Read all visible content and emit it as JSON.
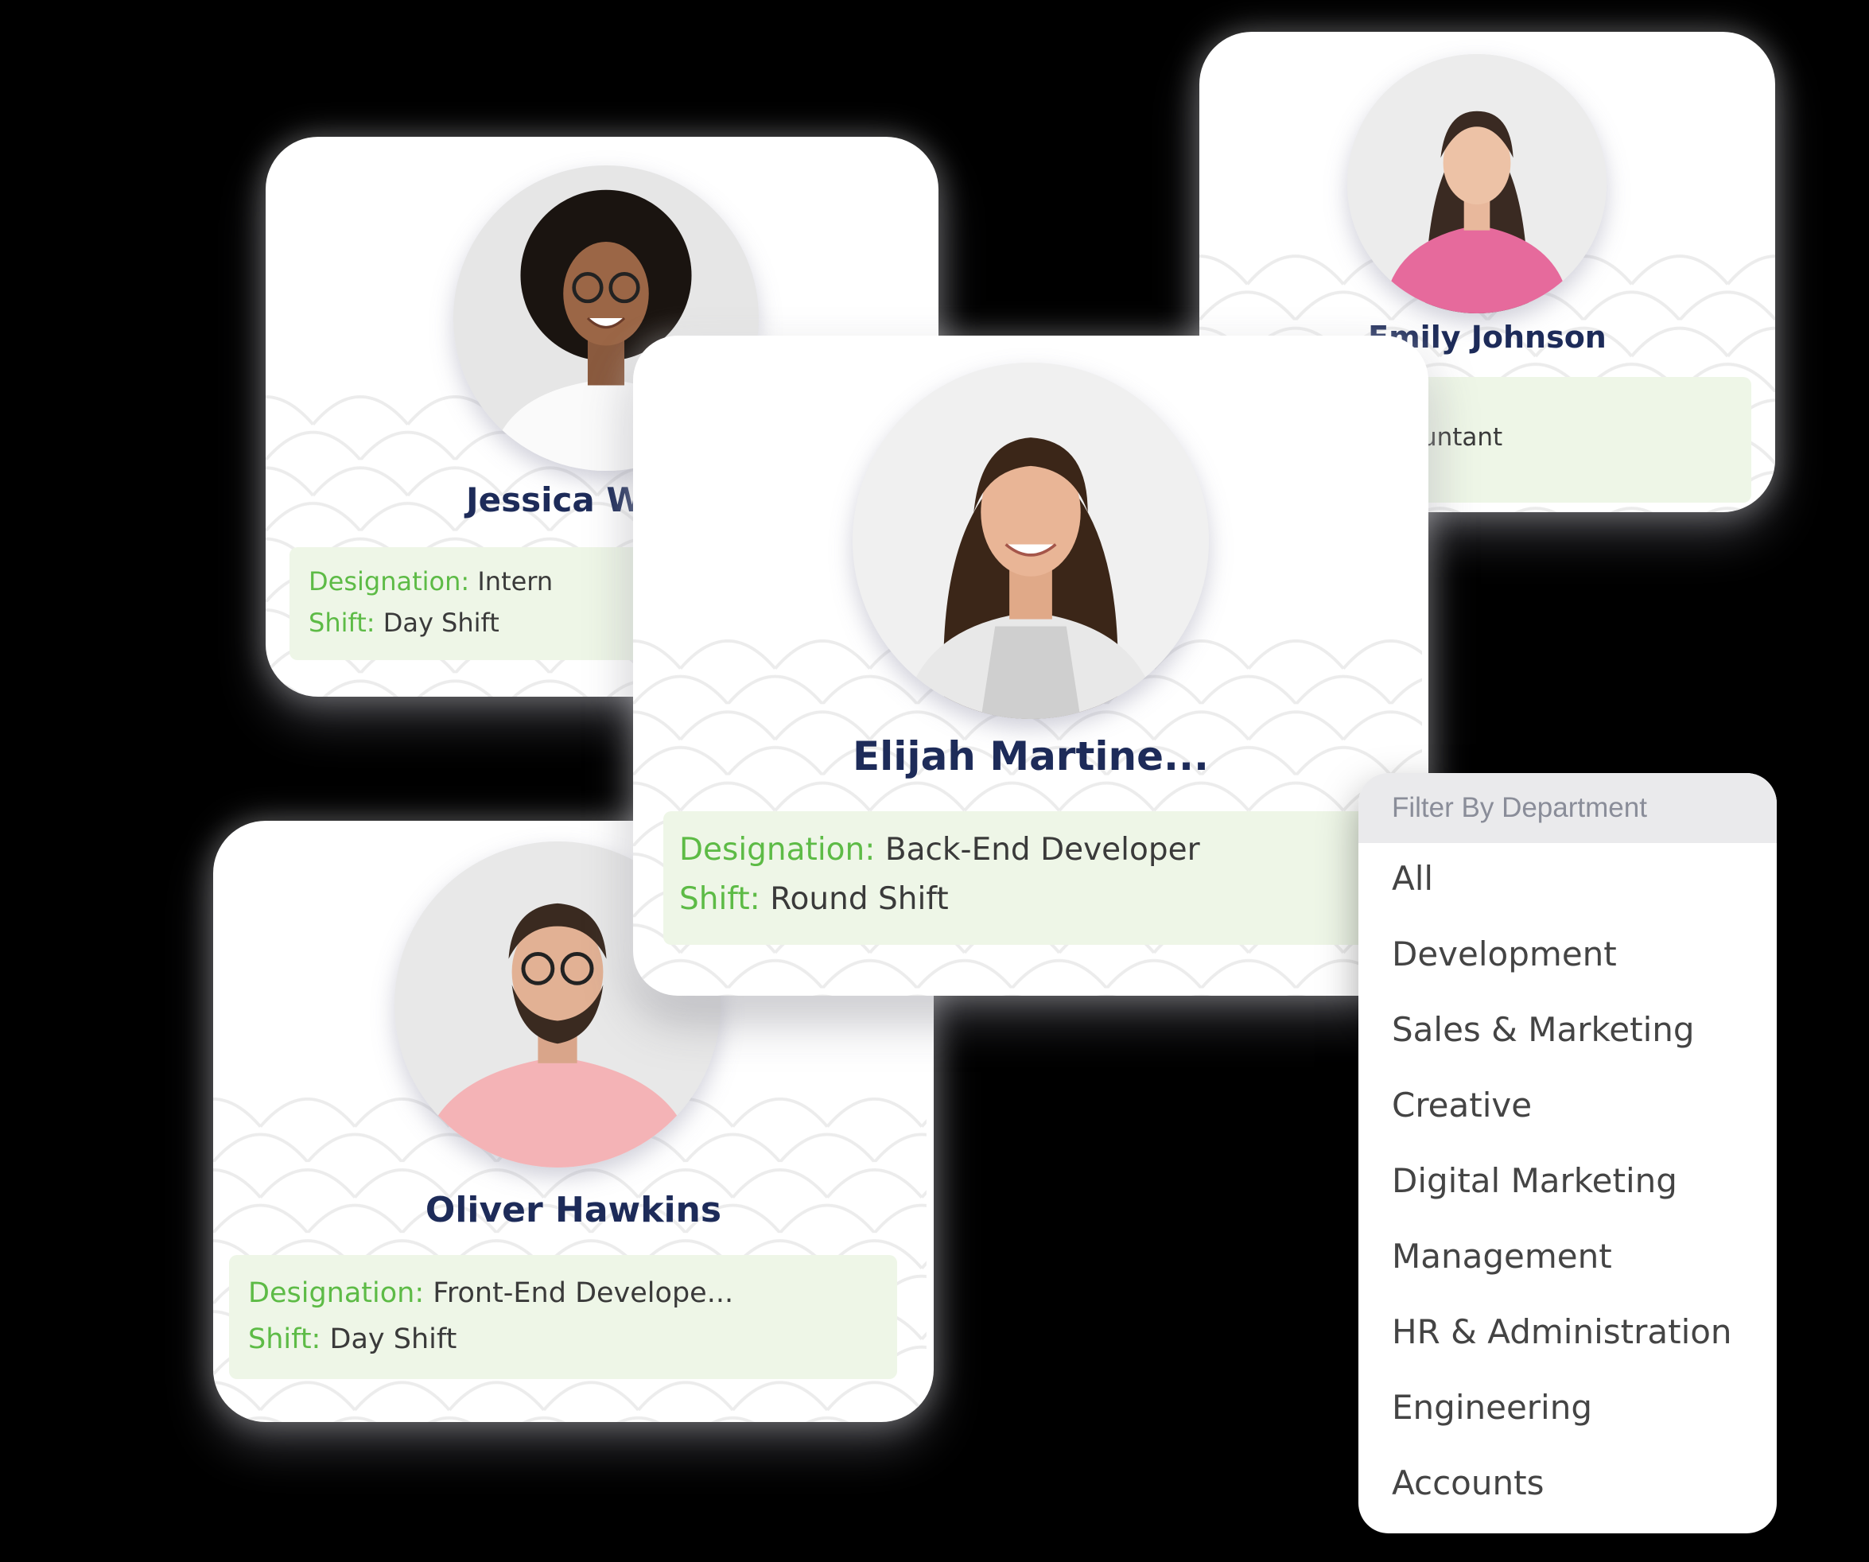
{
  "cards": {
    "jessica": {
      "name": "Jessica W",
      "designation_label": "Designation:",
      "designation": "Intern",
      "shift_label": "Shift:",
      "shift": "Day Shift"
    },
    "emily": {
      "name": "Emily Johnson",
      "designation": "ountant"
    },
    "elijah": {
      "name": "Elijah Martine...",
      "designation_label": "Designation:",
      "designation": "Back-End Developer",
      "shift_label": "Shift:",
      "shift": "Round Shift"
    },
    "oliver": {
      "name": "Oliver Hawkins",
      "designation_label": "Designation:",
      "designation": "Front-End Develope...",
      "shift_label": "Shift:",
      "shift": "Day Shift"
    }
  },
  "filter": {
    "header": "Filter By Department",
    "items": [
      "All",
      "Development",
      "Sales & Marketing",
      "Creative",
      "Digital Marketing",
      "Management",
      "HR & Administration",
      "Engineering",
      "Accounts"
    ]
  },
  "colors": {
    "name": "#1d2b59",
    "label_green": "#5dbb46",
    "info_bg": "#eef6e7",
    "header_bg": "#eaeaec"
  }
}
